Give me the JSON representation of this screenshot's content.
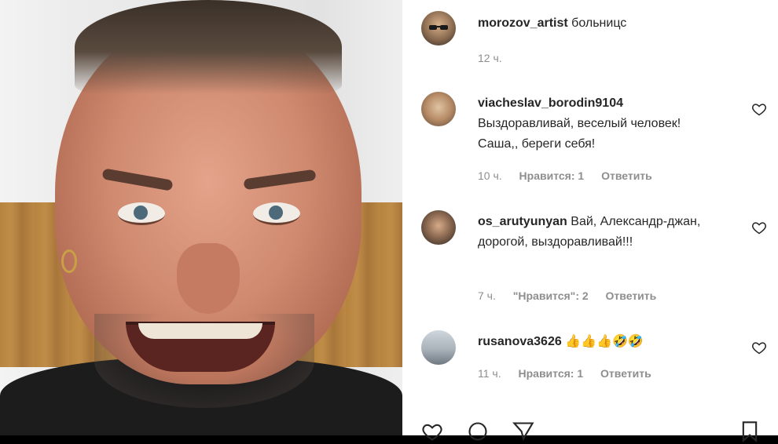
{
  "post": {
    "author": "morozov_artist",
    "caption": "больницс",
    "time": "12 ч."
  },
  "comments": [
    {
      "username": "viacheslav_borodin9104",
      "text": "Выздоравливай, веселый человек! Саша,, береги себя!",
      "time": "10 ч.",
      "likes": "Нравится: 1",
      "reply": "Ответить"
    },
    {
      "username": "os_arutyunyan",
      "text": "Вай, Александр-джан, дорогой, выздоравливай!!!",
      "time": "7 ч.",
      "likes": "\"Нравится\": 2",
      "reply": "Ответить"
    },
    {
      "username": "rusanova3626",
      "text": "👍👍👍🤣🤣",
      "time": "11 ч.",
      "likes": "Нравится: 1",
      "reply": "Ответить"
    }
  ],
  "icons": {
    "like": "heart-outline-icon",
    "comment": "comment-icon",
    "share": "paper-plane-icon",
    "save": "bookmark-icon"
  },
  "colors": {
    "text": "#262626",
    "meta": "#8e8e8e",
    "background": "#ffffff"
  }
}
